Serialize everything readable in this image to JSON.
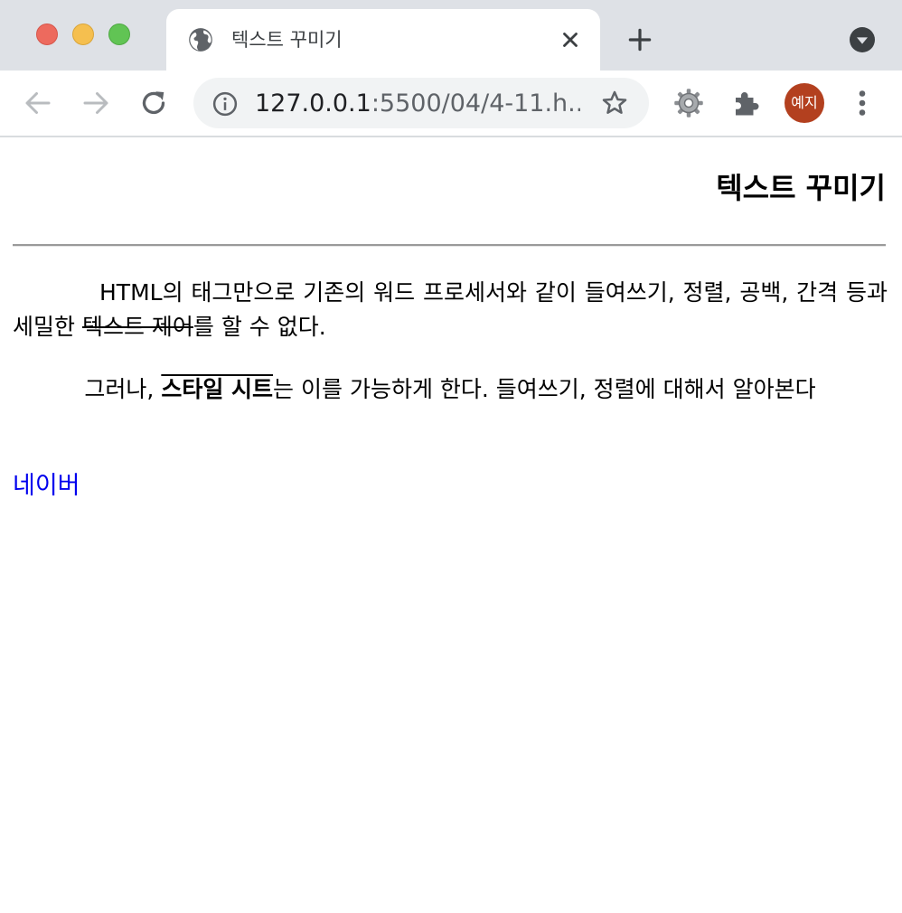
{
  "browser": {
    "tab": {
      "title": "텍스트 꾸미기",
      "favicon": "globe-icon",
      "close_icon": "close-icon"
    },
    "new_tab_icon": "plus-icon",
    "tab_search_icon": "chevron-down-circle-icon",
    "nav": {
      "back_icon": "arrow-left-icon",
      "forward_icon": "arrow-right-icon",
      "reload_icon": "reload-icon"
    },
    "omnibox": {
      "info_icon": "info-icon",
      "url_host": "127.0.0.1",
      "url_path": ":5500/04/4-11.h...",
      "star_icon": "star-icon"
    },
    "extensions": {
      "gear_icon": "gear-icon",
      "puzzle_icon": "puzzle-icon"
    },
    "profile_label": "예지",
    "menu_icon": "more-vertical-icon",
    "colors": {
      "tabstrip_bg": "#dee1e6",
      "avatar_bg": "#b3401f",
      "link": "#0000ee"
    }
  },
  "page": {
    "heading": "텍스트 꾸미기",
    "para1": {
      "before": "HTML의 태그만으로 기존의 워드 프로세서와 같이 들여쓰기, 정렬, 공백, 간격 등과 세밀한 ",
      "strike": "텍스트 제어",
      "after": "를 할 수 없다."
    },
    "para2": {
      "before": "그러나, ",
      "overline": "스타일 시트",
      "after": "는 이를 가능하게 한다. 들여쓰기, 정렬에 대해서 알아본다"
    },
    "link_text": "네이버"
  }
}
